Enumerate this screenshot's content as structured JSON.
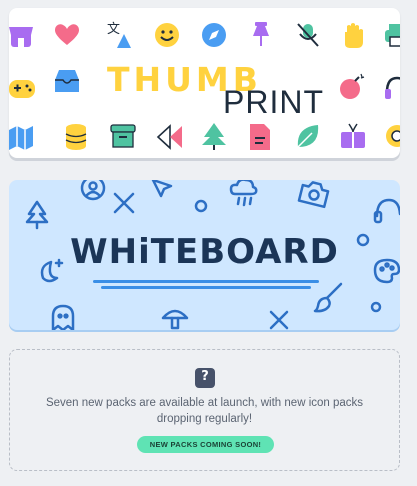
{
  "packs": [
    {
      "name_part1": "THUMB",
      "name_part2": "PRINT",
      "colors": {
        "yellow": "#ffd23f",
        "dark": "#1f2d3d",
        "pink": "#f46b8a",
        "green": "#4fc3a1",
        "blue": "#4a9df2",
        "purple": "#a86cf0"
      },
      "icons": [
        "shop-icon",
        "heart-icon",
        "translate-icon",
        "smile-icon",
        "compass-icon",
        "pin-icon",
        "mic-off-icon",
        "hand-icon",
        "printer-icon",
        "gamepad-icon",
        "inbox-icon",
        "bomb-icon",
        "headphones-icon",
        "map-icon",
        "database-icon",
        "archive-icon",
        "rewind-icon",
        "tree-icon",
        "document-icon",
        "leaf-icon",
        "gift-icon",
        "settings-icon"
      ]
    },
    {
      "name": "WHiTEBOARD",
      "colors": {
        "background": "#cfe7ff",
        "ink": "#1b3557",
        "accent": "#3a8ee6"
      },
      "doodles": [
        "tree-icon",
        "user-icon",
        "arrow-icon",
        "cross-icon",
        "cloud-rain-icon",
        "camera-icon",
        "headphones-icon",
        "moon-icon",
        "palette-icon",
        "ghost-icon",
        "mushroom-icon",
        "brush-icon",
        "circle-icon"
      ]
    }
  ],
  "coming_soon": {
    "icon": "mystery-box-icon",
    "icon_glyph": "?",
    "description": "Seven new packs are available at launch, with new icon packs dropping regularly!",
    "badge": "NEW PACKS COMING SOON!",
    "badge_color": "#5fe3b4"
  }
}
